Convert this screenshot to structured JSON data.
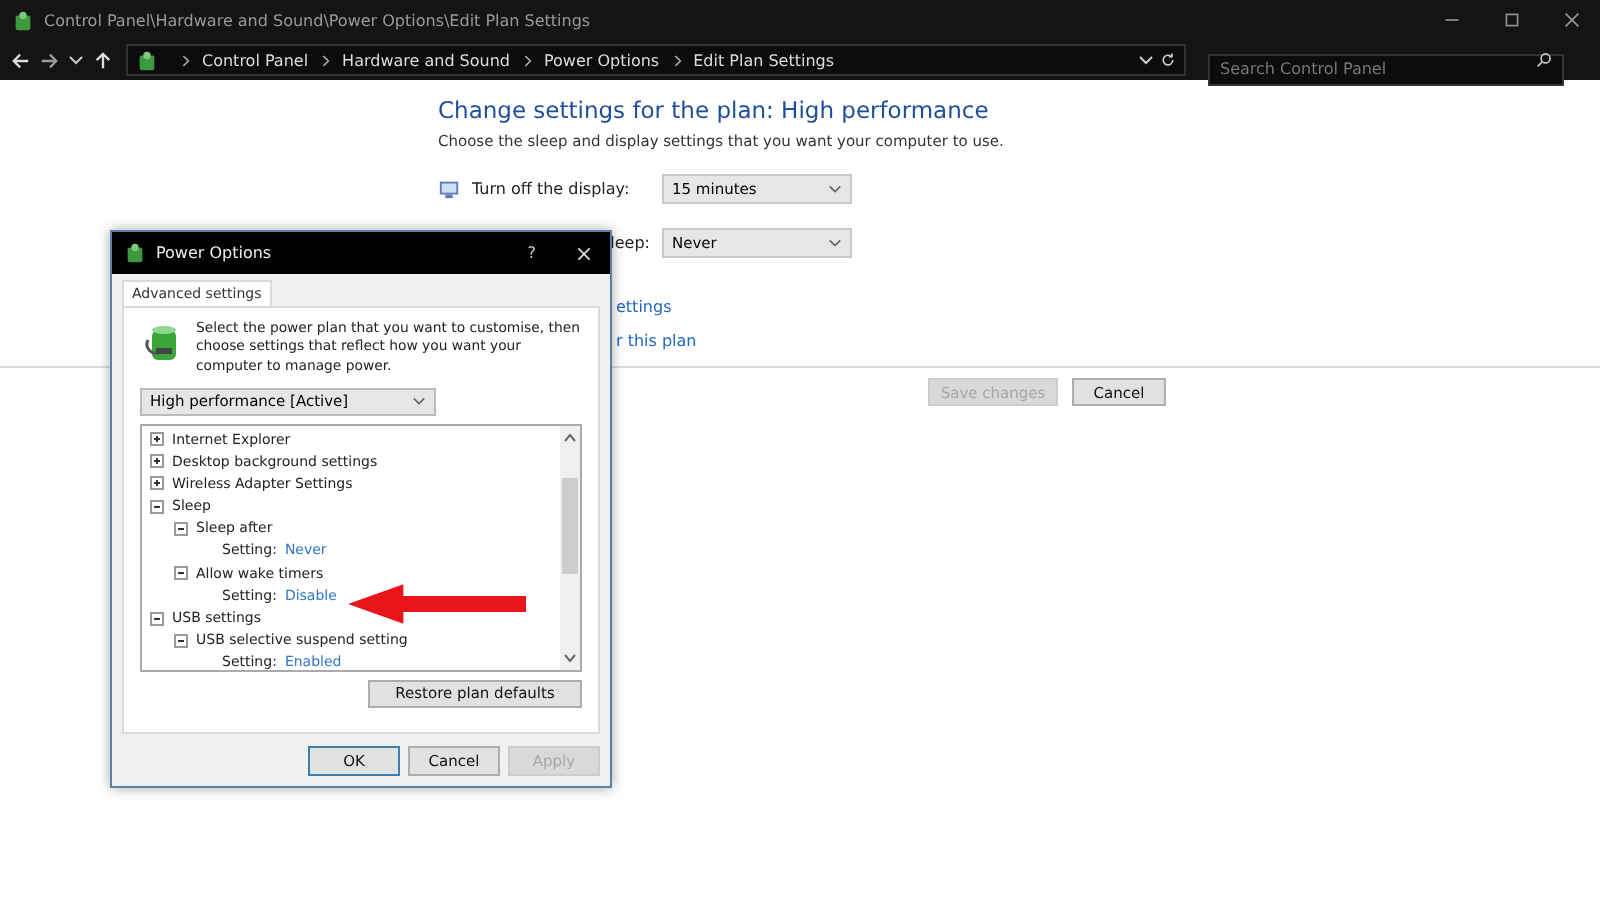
{
  "window": {
    "title": "Control Panel\\Hardware and Sound\\Power Options\\Edit Plan Settings"
  },
  "address_bar": {
    "breadcrumbs": [
      "Control Panel",
      "Hardware and Sound",
      "Power Options",
      "Edit Plan Settings"
    ],
    "search": {
      "placeholder": "Search Control Panel"
    }
  },
  "plan": {
    "heading": "Change settings for the plan: High performance",
    "subtitle": "Choose the sleep and display settings that you want your computer to use.",
    "rows": [
      {
        "label": "Turn off the display:",
        "value": "15 minutes",
        "covered": false
      },
      {
        "label": "leep:",
        "value": "Never",
        "covered": true
      }
    ],
    "links": [
      "ettings",
      "r this plan"
    ],
    "buttons": [
      {
        "label": "Save changes",
        "disabled": true
      },
      {
        "label": "Cancel",
        "disabled": false
      }
    ]
  },
  "dialog": {
    "title": "Power Options",
    "help": "?",
    "tabs": [
      {
        "label": "Advanced settings",
        "selected": true
      }
    ],
    "intro": "Select the power plan that you want to customise, then choose settings that reflect how you want your computer to manage power.",
    "plan_dropdown": "High performance [Active]",
    "tree": [
      {
        "kind": "group",
        "label": "Internet Explorer",
        "expanded": false
      },
      {
        "kind": "group",
        "label": "Desktop background settings",
        "expanded": false
      },
      {
        "kind": "group",
        "label": "Wireless Adapter Settings",
        "expanded": false
      },
      {
        "kind": "group",
        "label": "Sleep",
        "expanded": true,
        "children": [
          {
            "kind": "group",
            "label": "Sleep after",
            "expanded": true,
            "children": [
              {
                "kind": "setting",
                "label": "Setting:",
                "value": "Never"
              }
            ]
          },
          {
            "kind": "group",
            "label": "Allow wake timers",
            "expanded": true,
            "children": [
              {
                "kind": "setting",
                "label": "Setting:",
                "value": "Disable"
              }
            ]
          }
        ]
      },
      {
        "kind": "group",
        "label": "USB settings",
        "expanded": true,
        "children": [
          {
            "kind": "group",
            "label": "USB selective suspend setting",
            "expanded": true,
            "children": [
              {
                "kind": "setting",
                "label": "Setting:",
                "value": "Enabled"
              }
            ]
          }
        ]
      }
    ],
    "restore_button": "Restore plan defaults",
    "buttons": [
      {
        "label": "OK",
        "disabled": false
      },
      {
        "label": "Cancel",
        "disabled": false
      },
      {
        "label": "Apply",
        "disabled": true
      }
    ]
  }
}
